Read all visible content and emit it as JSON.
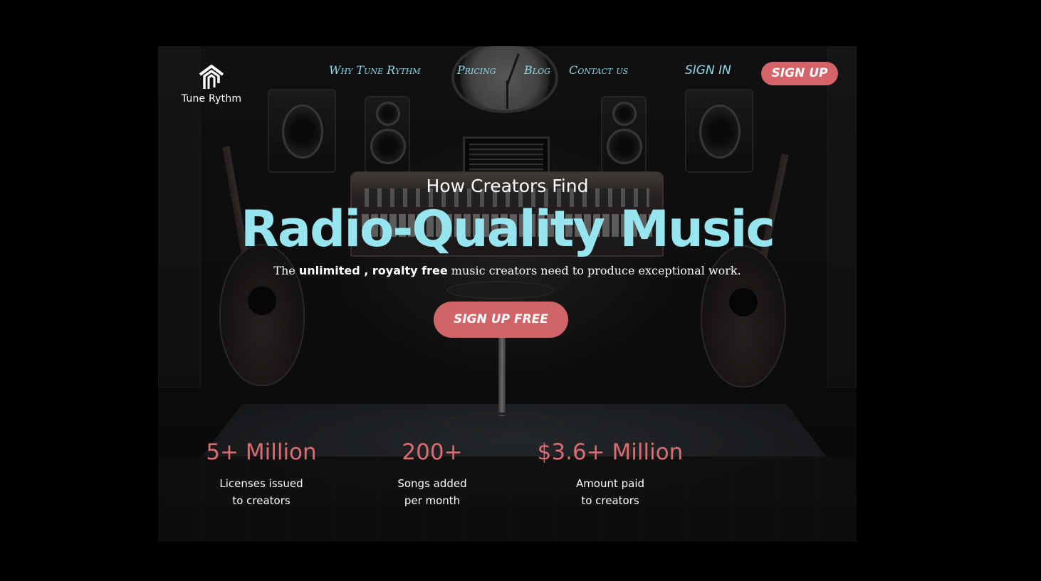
{
  "brand": {
    "name": "Tune Rythm",
    "logo_icon": "tune-rythm-logo-icon"
  },
  "nav": {
    "items": [
      {
        "label": "Why Tune Rythm"
      },
      {
        "label": "Pricing"
      },
      {
        "label": "Blog"
      },
      {
        "label": "Contact us"
      }
    ],
    "sign_in": "SIGN IN",
    "sign_up": "SIGN UP"
  },
  "hero": {
    "pre_title": "How Creators Find",
    "title": "Radio-Quality Music",
    "tagline_start": "The ",
    "tagline_bold1": "unlimited",
    "tagline_sep": " , ",
    "tagline_bold2": "royalty free",
    "tagline_end": " music creators need to produce exceptional work.",
    "cta": "SIGN UP FREE"
  },
  "stats": [
    {
      "value": "5+ Million",
      "label": "Licenses issued\nto creators"
    },
    {
      "value": "200+",
      "label": "Songs added\nper month"
    },
    {
      "value": "$3.6+ Million",
      "label": "Amount paid\nto creators"
    }
  ],
  "colors": {
    "accent": "#d46469",
    "title": "#97e5ee",
    "nav": "#8ed7e4",
    "background": "#000000"
  }
}
